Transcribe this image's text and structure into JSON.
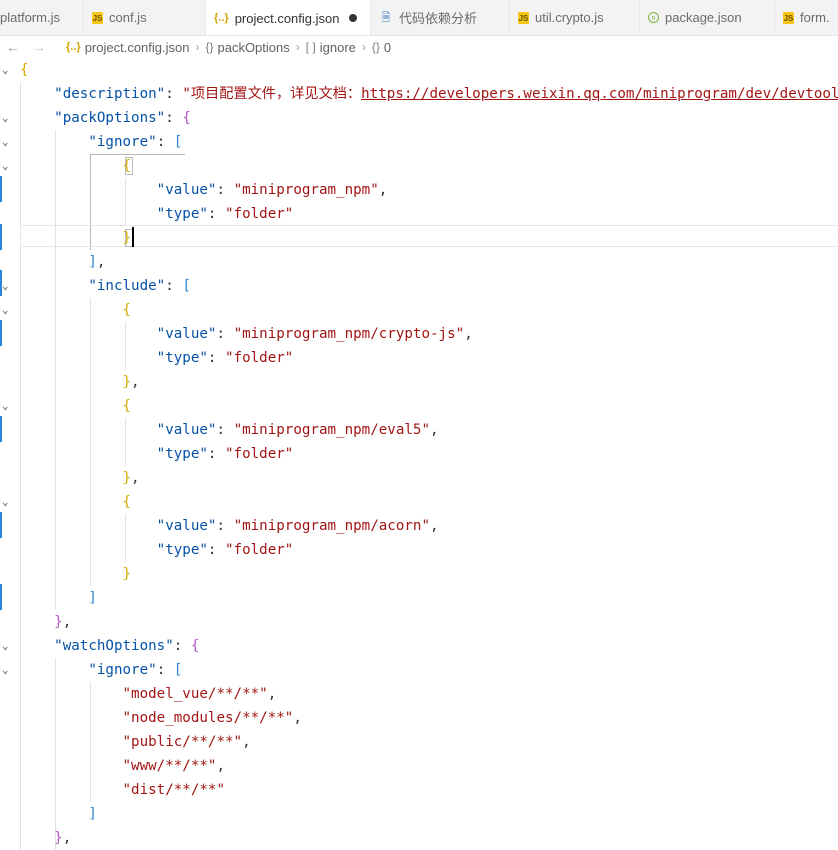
{
  "tabs": [
    {
      "label": "platform.js",
      "icon": "js-file-icon"
    },
    {
      "label": "conf.js",
      "icon": "js-file-icon"
    },
    {
      "label": "project.config.json",
      "icon": "json-file-icon",
      "active": true,
      "modified": true
    },
    {
      "label": "代码依赖分析",
      "icon": "document-icon"
    },
    {
      "label": "util.crypto.js",
      "icon": "js-file-icon"
    },
    {
      "label": "package.json",
      "icon": "node-package-icon"
    },
    {
      "label": "form.",
      "icon": "js-file-icon"
    }
  ],
  "breadcrumb": {
    "file_icon": "{..}",
    "file": "project.config.json",
    "obj_sym": "{}",
    "item1": "packOptions",
    "arr_sym": "[ ]",
    "item2": "ignore",
    "obj_sym2": "{}",
    "item3": "0"
  },
  "code": {
    "l1": "{",
    "description_key": "\"description\"",
    "description_val": "\"项目配置文件，详见文档：",
    "description_url": "https://developers.weixin.qq.com/miniprogram/dev/devtools/projectconfig.html",
    "packOptions_key": "\"packOptions\"",
    "ignore_key": "\"ignore\"",
    "value_key": "\"value\"",
    "type_key": "\"type\"",
    "include_key": "\"include\"",
    "v_npm": "\"miniprogram_npm\"",
    "v_crypto": "\"miniprogram_npm/crypto-js\"",
    "v_eval5": "\"miniprogram_npm/eval5\"",
    "v_acorn": "\"miniprogram_npm/acorn\"",
    "folder": "\"folder\"",
    "watchOptions_key": "\"watchOptions\"",
    "w1": "\"model_vue/**/**\"",
    "w2": "\"node_modules/**/**\"",
    "w3": "\"public/**/**\"",
    "w4": "\"www/**/**\"",
    "w5": "\"dist/**/**\""
  }
}
